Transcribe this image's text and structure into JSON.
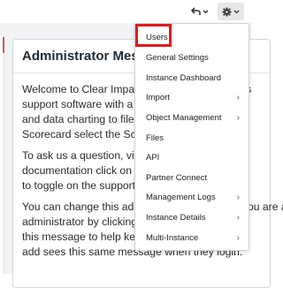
{
  "card": {
    "title": "Administrator Message",
    "paragraphs": [
      [
        "Welcome to Clear Impact Scorecard, our results",
        "support software with a wide range of features",
        "and data charting to file/publish your",
        "Scorecard select the Scorecard menu option."
      ],
      [
        "To ask us a question, view the",
        "documentation click on the Help",
        "to toggle on the support tool."
      ],
      [
        "You can change this administrator message if you are an",
        "administrator by clicking on the settings",
        "this message to help keep",
        "add sees this same message when they login."
      ]
    ]
  },
  "menu": {
    "items": [
      {
        "label": "Users",
        "submenu": false
      },
      {
        "label": "General Settings",
        "submenu": false
      },
      {
        "label": "Instance Dashboard",
        "submenu": false
      },
      {
        "label": "Import",
        "submenu": true
      },
      {
        "label": "Object Management",
        "submenu": true
      },
      {
        "label": "Files",
        "submenu": false
      },
      {
        "label": "API",
        "submenu": false
      },
      {
        "label": "Partner Connect",
        "submenu": false
      },
      {
        "label": "Management Logs",
        "submenu": true
      },
      {
        "label": "Instance Details",
        "submenu": true
      },
      {
        "label": "Multi-Instance",
        "submenu": true
      }
    ]
  },
  "colors": {
    "highlight": "#e0191e"
  },
  "icons": {
    "undo": "undo-icon",
    "gear": "gear-icon",
    "chevron": "chevron-down-icon",
    "submenu": "chevron-right-icon"
  }
}
